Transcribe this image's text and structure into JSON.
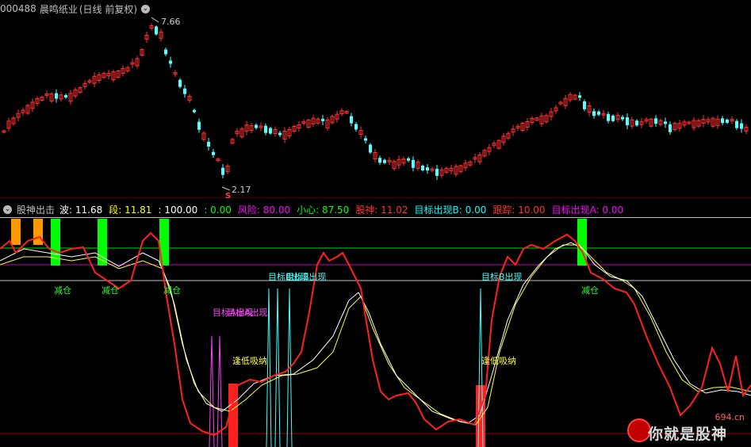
{
  "top_header": {
    "code": "000488",
    "name": "晨鸣纸业",
    "mode": "(日线 前复权)"
  },
  "price_chart": {
    "high_label": "7.66",
    "low_label": "2.17",
    "low_marker": "S"
  },
  "indicator_header": {
    "name": "股神出击",
    "items": [
      {
        "text": "波: 11.68",
        "color": "#ffffff"
      },
      {
        "text": "段: 11.81",
        "color": "#ffff00"
      },
      {
        "text": ": 100.00",
        "color": "#ffffff"
      },
      {
        "text": ": 0.00",
        "color": "#00ff00"
      },
      {
        "text": "风险: 80.00",
        "color": "#ff00ff"
      },
      {
        "text": "小心: 87.50",
        "color": "#00ff00"
      },
      {
        "text": "股神: 11.02",
        "color": "#ff3030"
      },
      {
        "text": "目标出现B: 0.00",
        "color": "#00ffff"
      },
      {
        "text": "跟踪: 10.00",
        "color": "#ff3030"
      },
      {
        "text": "目标出现A: 0.00",
        "color": "#ff00ff"
      }
    ]
  },
  "annotations": {
    "reduce": "减仓",
    "target_b": "目标B出现",
    "target_a": "目标A出现",
    "buy_low": "逢低吸纳"
  },
  "watermark": {
    "site": "694.cn",
    "text": "你就是股神"
  },
  "colors": {
    "up": "#ff3232",
    "down": "#54ffff",
    "red_line": "#ff2020",
    "white_line": "#ffffff",
    "yellow_line": "#ffff40",
    "green_bar": "#00ff00",
    "orange_bar": "#ff9900",
    "magenta": "#ff40ff",
    "cyan": "#40ffff"
  }
}
